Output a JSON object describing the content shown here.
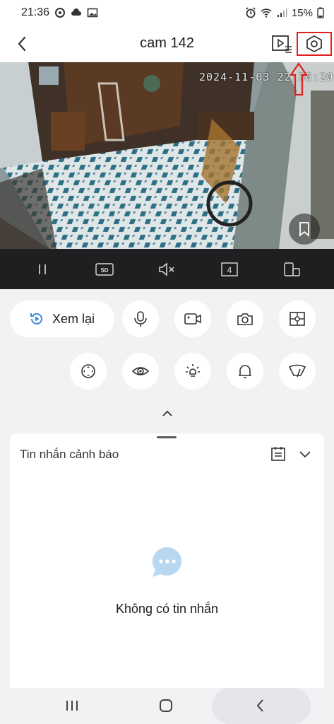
{
  "status_bar": {
    "time": "21:36",
    "battery": "15%",
    "left_icons": [
      "sync-icon",
      "cloud-icon",
      "gallery-icon"
    ],
    "right_icons": [
      "alarm-icon",
      "wifi-icon",
      "signal-icon",
      "battery-icon"
    ]
  },
  "header": {
    "title": "cam 142",
    "back_icon": "chevron-left-icon",
    "playback_list_icon": "playback-list-icon",
    "settings_icon": "hexagon-settings-icon"
  },
  "video": {
    "timestamp": "2024-11-03 22:36:20",
    "bookmark_icon": "bookmark-icon"
  },
  "control_bar": {
    "items": [
      {
        "name": "pause",
        "label": "| |"
      },
      {
        "name": "quality",
        "label": "SD"
      },
      {
        "name": "mute",
        "label": "muted"
      },
      {
        "name": "split-view",
        "label": "4"
      },
      {
        "name": "orientation",
        "label": "rotate"
      }
    ]
  },
  "actions": {
    "replay_label": "Xem lại",
    "round_buttons": [
      "microphone-icon",
      "video-record-icon",
      "camera-icon",
      "grid-settings-icon",
      "ptz-icon",
      "eye-privacy-icon",
      "light-icon",
      "bell-icon",
      "wiper-icon"
    ]
  },
  "alerts": {
    "title": "Tin nhắn cảnh báo",
    "empty_text": "Không có tin nhắn"
  },
  "colors": {
    "highlight_red": "#e02020",
    "accent_blue": "#3b8bd9",
    "empty_icon_blue": "#b8d8f2"
  }
}
